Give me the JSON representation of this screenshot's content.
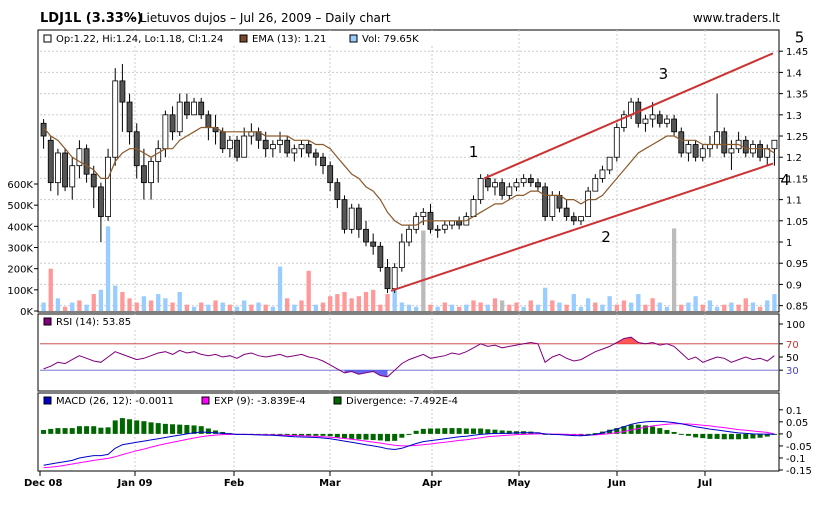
{
  "header": {
    "ticker": "LDJ1L (3.33%)",
    "subtitle": " – Lietuvos dujos – Jul 26, 2009 – Daily chart",
    "site": "www.traders.lt"
  },
  "legend": {
    "ohlc": "Op:1.22, Hi:1.24, Lo:1.18, Cl:1.24",
    "ema": "EMA (13): 1.21",
    "vol": "Vol: 79.65K",
    "rsi": "RSI (14): 53.85",
    "macd": "MACD (26, 12): -0.0011",
    "exp": "EXP (9): -3.839E-4",
    "divergence": "Divergence: -7.492E-4"
  },
  "colors": {
    "up_candle": "#ffffff",
    "down_candle": "#555555",
    "ema": "#8b5a2b",
    "channel": "#cc3333",
    "vol_up": "#99ccff",
    "vol_down": "#ff9999",
    "rsi": "#800080",
    "macd": "#0000cc",
    "exp": "#ff00ff",
    "divergence": "#006600"
  },
  "chart_data": {
    "type": "candlestick",
    "x_labels": [
      "Dec 08",
      "Jan 09",
      "Feb",
      "Mar",
      "Apr",
      "May",
      "Jun",
      "Jul"
    ],
    "price_ticks": [
      "1.45",
      "1.4",
      "1.35",
      "1.3",
      "1.25",
      "1.2",
      "1.15",
      "1.1",
      "1.05",
      "1",
      "0.95",
      "0.9",
      "0.85"
    ],
    "price_range": [
      0.835,
      1.5
    ],
    "volume_ticks": [
      "600K",
      "500K",
      "400K",
      "300K",
      "200K",
      "100K",
      "0K"
    ],
    "volume_range": [
      0,
      600000
    ],
    "rsi_ticks": [
      "100",
      "70",
      "50",
      "30"
    ],
    "rsi_levels": [
      70,
      30
    ],
    "macd_ticks": [
      "0.1",
      "0.05",
      "0",
      "-0.05",
      "-0.1",
      "-0.15"
    ],
    "macd_range": [
      -0.15,
      0.12
    ],
    "channel_labels": [
      "1",
      "2",
      "3",
      "4",
      "5"
    ],
    "candles": [
      [
        1.28,
        1.29,
        1.22,
        1.25
      ],
      [
        1.24,
        1.25,
        1.12,
        1.14
      ],
      [
        1.14,
        1.22,
        1.11,
        1.21
      ],
      [
        1.21,
        1.22,
        1.12,
        1.13
      ],
      [
        1.13,
        1.2,
        1.1,
        1.18
      ],
      [
        1.18,
        1.24,
        1.15,
        1.22
      ],
      [
        1.22,
        1.23,
        1.14,
        1.16
      ],
      [
        1.16,
        1.18,
        1.08,
        1.13
      ],
      [
        1.13,
        1.14,
        1.0,
        1.06
      ],
      [
        1.06,
        1.22,
        1.05,
        1.2
      ],
      [
        1.2,
        1.41,
        1.18,
        1.38
      ],
      [
        1.38,
        1.42,
        1.26,
        1.33
      ],
      [
        1.33,
        1.35,
        1.23,
        1.26
      ],
      [
        1.26,
        1.28,
        1.15,
        1.18
      ],
      [
        1.18,
        1.22,
        1.1,
        1.14
      ],
      [
        1.14,
        1.2,
        1.1,
        1.19
      ],
      [
        1.19,
        1.24,
        1.14,
        1.22
      ],
      [
        1.22,
        1.31,
        1.2,
        1.3
      ],
      [
        1.3,
        1.32,
        1.24,
        1.26
      ],
      [
        1.26,
        1.35,
        1.25,
        1.33
      ],
      [
        1.33,
        1.35,
        1.29,
        1.3
      ],
      [
        1.3,
        1.34,
        1.3,
        1.33
      ],
      [
        1.33,
        1.34,
        1.29,
        1.3
      ],
      [
        1.3,
        1.31,
        1.24,
        1.27
      ],
      [
        1.27,
        1.3,
        1.23,
        1.26
      ],
      [
        1.26,
        1.27,
        1.21,
        1.22
      ],
      [
        1.22,
        1.25,
        1.2,
        1.24
      ],
      [
        1.24,
        1.25,
        1.19,
        1.2
      ],
      [
        1.2,
        1.27,
        1.2,
        1.25
      ],
      [
        1.25,
        1.28,
        1.23,
        1.26
      ],
      [
        1.26,
        1.27,
        1.22,
        1.24
      ],
      [
        1.24,
        1.26,
        1.2,
        1.22
      ],
      [
        1.22,
        1.24,
        1.2,
        1.23
      ],
      [
        1.23,
        1.26,
        1.21,
        1.24
      ],
      [
        1.24,
        1.25,
        1.2,
        1.21
      ],
      [
        1.21,
        1.23,
        1.19,
        1.22
      ],
      [
        1.22,
        1.24,
        1.2,
        1.23
      ],
      [
        1.23,
        1.24,
        1.2,
        1.21
      ],
      [
        1.21,
        1.22,
        1.18,
        1.2
      ],
      [
        1.2,
        1.21,
        1.16,
        1.18
      ],
      [
        1.18,
        1.19,
        1.12,
        1.14
      ],
      [
        1.14,
        1.15,
        1.08,
        1.1
      ],
      [
        1.1,
        1.11,
        1.02,
        1.03
      ],
      [
        1.03,
        1.09,
        1.02,
        1.08
      ],
      [
        1.08,
        1.09,
        1.01,
        1.03
      ],
      [
        1.03,
        1.05,
        0.99,
        1.0
      ],
      [
        1.0,
        1.02,
        0.97,
        0.99
      ],
      [
        0.99,
        1.0,
        0.93,
        0.94
      ],
      [
        0.94,
        0.96,
        0.88,
        0.89
      ],
      [
        0.89,
        0.95,
        0.88,
        0.94
      ],
      [
        0.94,
        1.02,
        0.93,
        1.0
      ],
      [
        1.0,
        1.04,
        0.99,
        1.03
      ],
      [
        1.03,
        1.07,
        1.02,
        1.06
      ],
      [
        1.06,
        1.08,
        1.04,
        1.07
      ],
      [
        1.07,
        1.09,
        1.02,
        1.03
      ],
      [
        1.03,
        1.04,
        1.01,
        1.03
      ],
      [
        1.03,
        1.05,
        1.02,
        1.04
      ],
      [
        1.04,
        1.05,
        1.03,
        1.05
      ],
      [
        1.05,
        1.06,
        1.03,
        1.04
      ],
      [
        1.04,
        1.07,
        1.04,
        1.06
      ],
      [
        1.06,
        1.11,
        1.06,
        1.1
      ],
      [
        1.1,
        1.16,
        1.09,
        1.15
      ],
      [
        1.15,
        1.16,
        1.12,
        1.13
      ],
      [
        1.13,
        1.15,
        1.11,
        1.14
      ],
      [
        1.14,
        1.15,
        1.1,
        1.11
      ],
      [
        1.11,
        1.14,
        1.1,
        1.13
      ],
      [
        1.13,
        1.15,
        1.12,
        1.14
      ],
      [
        1.14,
        1.16,
        1.13,
        1.15
      ],
      [
        1.15,
        1.16,
        1.13,
        1.14
      ],
      [
        1.14,
        1.15,
        1.12,
        1.13
      ],
      [
        1.13,
        1.14,
        1.05,
        1.06
      ],
      [
        1.06,
        1.12,
        1.05,
        1.11
      ],
      [
        1.11,
        1.12,
        1.07,
        1.08
      ],
      [
        1.08,
        1.1,
        1.05,
        1.06
      ],
      [
        1.06,
        1.07,
        1.04,
        1.05
      ],
      [
        1.05,
        1.06,
        1.04,
        1.06
      ],
      [
        1.06,
        1.13,
        1.06,
        1.12
      ],
      [
        1.12,
        1.16,
        1.12,
        1.15
      ],
      [
        1.15,
        1.18,
        1.14,
        1.17
      ],
      [
        1.17,
        1.2,
        1.16,
        1.2
      ],
      [
        1.2,
        1.28,
        1.19,
        1.27
      ],
      [
        1.27,
        1.31,
        1.26,
        1.3
      ],
      [
        1.3,
        1.34,
        1.29,
        1.33
      ],
      [
        1.33,
        1.34,
        1.27,
        1.28
      ],
      [
        1.28,
        1.3,
        1.26,
        1.29
      ],
      [
        1.29,
        1.33,
        1.27,
        1.3
      ],
      [
        1.3,
        1.31,
        1.27,
        1.28
      ],
      [
        1.28,
        1.3,
        1.27,
        1.29
      ],
      [
        1.29,
        1.3,
        1.25,
        1.26
      ],
      [
        1.26,
        1.27,
        1.2,
        1.21
      ],
      [
        1.21,
        1.24,
        1.19,
        1.23
      ],
      [
        1.23,
        1.24,
        1.19,
        1.2
      ],
      [
        1.2,
        1.23,
        1.19,
        1.22
      ],
      [
        1.22,
        1.25,
        1.2,
        1.23
      ],
      [
        1.23,
        1.35,
        1.22,
        1.26
      ],
      [
        1.26,
        1.27,
        1.2,
        1.21
      ],
      [
        1.21,
        1.24,
        1.17,
        1.22
      ],
      [
        1.22,
        1.26,
        1.21,
        1.24
      ],
      [
        1.24,
        1.25,
        1.2,
        1.21
      ],
      [
        1.21,
        1.24,
        1.2,
        1.23
      ],
      [
        1.23,
        1.24,
        1.19,
        1.2
      ],
      [
        1.2,
        1.23,
        1.18,
        1.22
      ],
      [
        1.22,
        1.24,
        1.18,
        1.24
      ]
    ],
    "volumes": [
      [
        40000,
        0
      ],
      [
        200000,
        1
      ],
      [
        60000,
        0
      ],
      [
        20000,
        1
      ],
      [
        40000,
        0
      ],
      [
        50000,
        1
      ],
      [
        30000,
        0
      ],
      [
        80000,
        1
      ],
      [
        100000,
        0
      ],
      [
        400000,
        0
      ],
      [
        120000,
        0
      ],
      [
        90000,
        1
      ],
      [
        60000,
        1
      ],
      [
        40000,
        1
      ],
      [
        70000,
        0
      ],
      [
        50000,
        1
      ],
      [
        80000,
        0
      ],
      [
        60000,
        0
      ],
      [
        40000,
        1
      ],
      [
        90000,
        0
      ],
      [
        30000,
        1
      ],
      [
        20000,
        0
      ],
      [
        40000,
        1
      ],
      [
        30000,
        0
      ],
      [
        50000,
        1
      ],
      [
        40000,
        0
      ],
      [
        30000,
        1
      ],
      [
        20000,
        0
      ],
      [
        50000,
        0
      ],
      [
        30000,
        1
      ],
      [
        40000,
        0
      ],
      [
        30000,
        1
      ],
      [
        20000,
        0
      ],
      [
        210000,
        0
      ],
      [
        60000,
        1
      ],
      [
        30000,
        0
      ],
      [
        50000,
        1
      ],
      [
        190000,
        1
      ],
      [
        30000,
        0
      ],
      [
        40000,
        1
      ],
      [
        70000,
        1
      ],
      [
        80000,
        1
      ],
      [
        90000,
        1
      ],
      [
        60000,
        1
      ],
      [
        70000,
        1
      ],
      [
        90000,
        1
      ],
      [
        100000,
        1
      ],
      [
        30000,
        1
      ],
      [
        80000,
        1
      ],
      [
        110000,
        0
      ],
      [
        40000,
        0
      ],
      [
        30000,
        0
      ],
      [
        20000,
        0
      ],
      [
        380000,
        2
      ],
      [
        30000,
        1
      ],
      [
        20000,
        0
      ],
      [
        40000,
        1
      ],
      [
        30000,
        0
      ],
      [
        20000,
        1
      ],
      [
        30000,
        0
      ],
      [
        50000,
        1
      ],
      [
        40000,
        1
      ],
      [
        30000,
        0
      ],
      [
        60000,
        1
      ],
      [
        50000,
        2
      ],
      [
        30000,
        1
      ],
      [
        40000,
        1
      ],
      [
        20000,
        0
      ],
      [
        50000,
        1
      ],
      [
        30000,
        0
      ],
      [
        110000,
        0
      ],
      [
        50000,
        1
      ],
      [
        40000,
        0
      ],
      [
        30000,
        1
      ],
      [
        80000,
        0
      ],
      [
        20000,
        0
      ],
      [
        60000,
        0
      ],
      [
        40000,
        1
      ],
      [
        30000,
        0
      ],
      [
        70000,
        0
      ],
      [
        30000,
        1
      ],
      [
        50000,
        1
      ],
      [
        40000,
        0
      ],
      [
        80000,
        0
      ],
      [
        30000,
        1
      ],
      [
        60000,
        1
      ],
      [
        40000,
        0
      ],
      [
        20000,
        0
      ],
      [
        390000,
        2
      ],
      [
        30000,
        1
      ],
      [
        40000,
        0
      ],
      [
        70000,
        0
      ],
      [
        30000,
        1
      ],
      [
        50000,
        0
      ],
      [
        20000,
        0
      ],
      [
        30000,
        1
      ],
      [
        40000,
        0
      ],
      [
        30000,
        1
      ],
      [
        60000,
        1
      ],
      [
        40000,
        0
      ],
      [
        20000,
        1
      ],
      [
        50000,
        0
      ],
      [
        79650,
        0
      ]
    ],
    "ema": [
      1.27,
      1.25,
      1.24,
      1.22,
      1.2,
      1.19,
      1.18,
      1.17,
      1.15,
      1.15,
      1.19,
      1.21,
      1.22,
      1.22,
      1.21,
      1.2,
      1.21,
      1.22,
      1.22,
      1.24,
      1.25,
      1.26,
      1.27,
      1.27,
      1.27,
      1.26,
      1.26,
      1.26,
      1.26,
      1.26,
      1.26,
      1.25,
      1.25,
      1.25,
      1.25,
      1.24,
      1.24,
      1.24,
      1.23,
      1.23,
      1.22,
      1.2,
      1.18,
      1.16,
      1.15,
      1.13,
      1.12,
      1.1,
      1.07,
      1.05,
      1.04,
      1.04,
      1.04,
      1.05,
      1.05,
      1.05,
      1.05,
      1.05,
      1.05,
      1.05,
      1.06,
      1.07,
      1.08,
      1.09,
      1.09,
      1.1,
      1.11,
      1.11,
      1.12,
      1.12,
      1.11,
      1.11,
      1.11,
      1.1,
      1.1,
      1.09,
      1.1,
      1.1,
      1.11,
      1.13,
      1.15,
      1.17,
      1.19,
      1.21,
      1.22,
      1.23,
      1.24,
      1.25,
      1.25,
      1.24,
      1.24,
      1.24,
      1.23,
      1.23,
      1.23,
      1.23,
      1.23,
      1.23,
      1.22,
      1.22,
      1.22,
      1.22,
      1.21
    ],
    "rsi": [
      32,
      36,
      42,
      40,
      46,
      52,
      48,
      44,
      42,
      50,
      58,
      54,
      50,
      46,
      48,
      52,
      56,
      58,
      54,
      60,
      56,
      58,
      54,
      52,
      54,
      50,
      52,
      48,
      54,
      56,
      52,
      50,
      52,
      54,
      50,
      52,
      54,
      50,
      48,
      44,
      38,
      32,
      26,
      28,
      24,
      26,
      28,
      22,
      20,
      30,
      40,
      46,
      50,
      54,
      48,
      50,
      52,
      56,
      54,
      58,
      64,
      70,
      66,
      68,
      64,
      66,
      68,
      70,
      72,
      70,
      42,
      50,
      54,
      48,
      44,
      46,
      52,
      58,
      62,
      66,
      72,
      78,
      80,
      72,
      70,
      72,
      68,
      70,
      66,
      56,
      46,
      50,
      42,
      46,
      50,
      48,
      42,
      46,
      50,
      46,
      48,
      44,
      52
    ],
    "macd": [
      -0.13,
      -0.125,
      -0.12,
      -0.115,
      -0.11,
      -0.1,
      -0.095,
      -0.09,
      -0.09,
      -0.085,
      -0.06,
      -0.045,
      -0.04,
      -0.035,
      -0.03,
      -0.025,
      -0.02,
      -0.015,
      -0.01,
      -0.005,
      0.0,
      0.005,
      0.008,
      0.006,
      0.004,
      0.002,
      0.0,
      -0.002,
      -0.002,
      -0.003,
      -0.004,
      -0.005,
      -0.006,
      -0.008,
      -0.01,
      -0.012,
      -0.013,
      -0.014,
      -0.015,
      -0.017,
      -0.02,
      -0.025,
      -0.03,
      -0.035,
      -0.04,
      -0.045,
      -0.05,
      -0.055,
      -0.062,
      -0.065,
      -0.06,
      -0.05,
      -0.04,
      -0.032,
      -0.028,
      -0.024,
      -0.02,
      -0.016,
      -0.012,
      -0.01,
      -0.006,
      -0.002,
      0.0,
      0.002,
      0.002,
      0.003,
      0.004,
      0.005,
      0.005,
      0.004,
      0.0,
      -0.002,
      -0.003,
      -0.005,
      -0.007,
      -0.008,
      -0.006,
      -0.002,
      0.004,
      0.012,
      0.02,
      0.03,
      0.04,
      0.046,
      0.05,
      0.052,
      0.052,
      0.05,
      0.047,
      0.042,
      0.036,
      0.03,
      0.025,
      0.02,
      0.016,
      0.012,
      0.008,
      0.004,
      0.002,
      0.0,
      -0.001,
      -0.001,
      -0.0011
    ],
    "exp": [
      -0.14,
      -0.138,
      -0.135,
      -0.13,
      -0.125,
      -0.12,
      -0.115,
      -0.11,
      -0.106,
      -0.102,
      -0.095,
      -0.086,
      -0.078,
      -0.07,
      -0.063,
      -0.055,
      -0.048,
      -0.041,
      -0.035,
      -0.029,
      -0.023,
      -0.017,
      -0.012,
      -0.008,
      -0.005,
      -0.003,
      -0.002,
      -0.002,
      -0.002,
      -0.002,
      -0.003,
      -0.003,
      -0.004,
      -0.005,
      -0.006,
      -0.007,
      -0.008,
      -0.009,
      -0.01,
      -0.012,
      -0.014,
      -0.016,
      -0.019,
      -0.022,
      -0.026,
      -0.03,
      -0.034,
      -0.038,
      -0.043,
      -0.047,
      -0.05,
      -0.05,
      -0.048,
      -0.045,
      -0.042,
      -0.038,
      -0.035,
      -0.031,
      -0.027,
      -0.024,
      -0.02,
      -0.016,
      -0.012,
      -0.009,
      -0.007,
      -0.005,
      -0.003,
      -0.002,
      -0.001,
      0.0,
      0.0,
      -0.001,
      -0.001,
      -0.002,
      -0.003,
      -0.004,
      -0.005,
      -0.004,
      -0.002,
      0.001,
      0.005,
      0.01,
      0.016,
      0.022,
      0.028,
      0.033,
      0.037,
      0.04,
      0.042,
      0.042,
      0.041,
      0.039,
      0.036,
      0.033,
      0.029,
      0.026,
      0.022,
      0.018,
      0.015,
      0.012,
      0.009,
      0.006,
      -0.0003839
    ]
  }
}
